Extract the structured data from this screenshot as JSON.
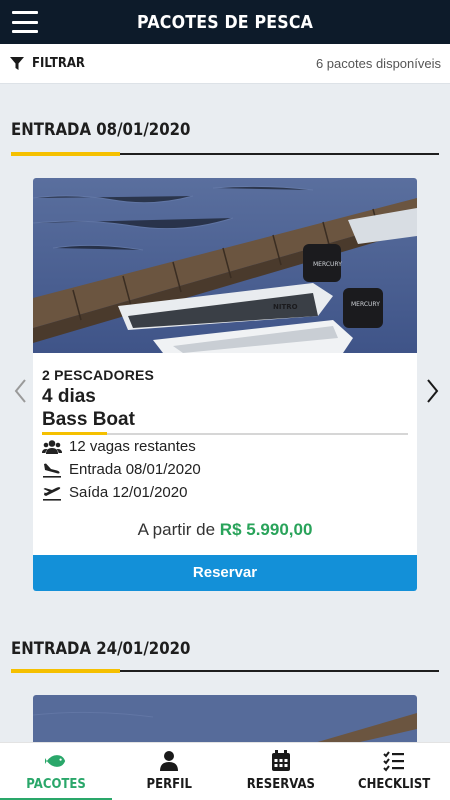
{
  "header": {
    "title": "PACOTES DE PESCA",
    "menu_icon": "hamburger-menu-icon"
  },
  "filter": {
    "label": "FILTRAR",
    "icon": "filter-icon",
    "count_text": "6 pacotes disponíveis"
  },
  "sections": [
    {
      "title": "ENTRADA 08/01/2020",
      "card": {
        "image": "bass-boat-photo",
        "pescadores": "2 PESCADORES",
        "dias": "4 dias",
        "boat": "Bass Boat",
        "vagas": "12 vagas restantes",
        "entrada": "Entrada 08/01/2020",
        "saida": "Saída 12/01/2020",
        "price_prefix": "A partir de",
        "price": "R$ 5.990,00",
        "button": "Reservar"
      }
    },
    {
      "title": "ENTRADA 24/01/2020"
    }
  ],
  "nav": [
    {
      "label": "PACOTES",
      "icon": "fish-icon",
      "active": true
    },
    {
      "label": "PERFIL",
      "icon": "user-icon",
      "active": false
    },
    {
      "label": "RESERVAS",
      "icon": "calendar-icon",
      "active": false
    },
    {
      "label": "CHECKLIST",
      "icon": "checklist-icon",
      "active": false
    }
  ],
  "colors": {
    "header_bg": "#0d1b2a",
    "accent_yellow": "#f5c000",
    "price_green": "#29a35a",
    "button_blue": "#1390d8",
    "nav_active": "#2aa76a"
  }
}
